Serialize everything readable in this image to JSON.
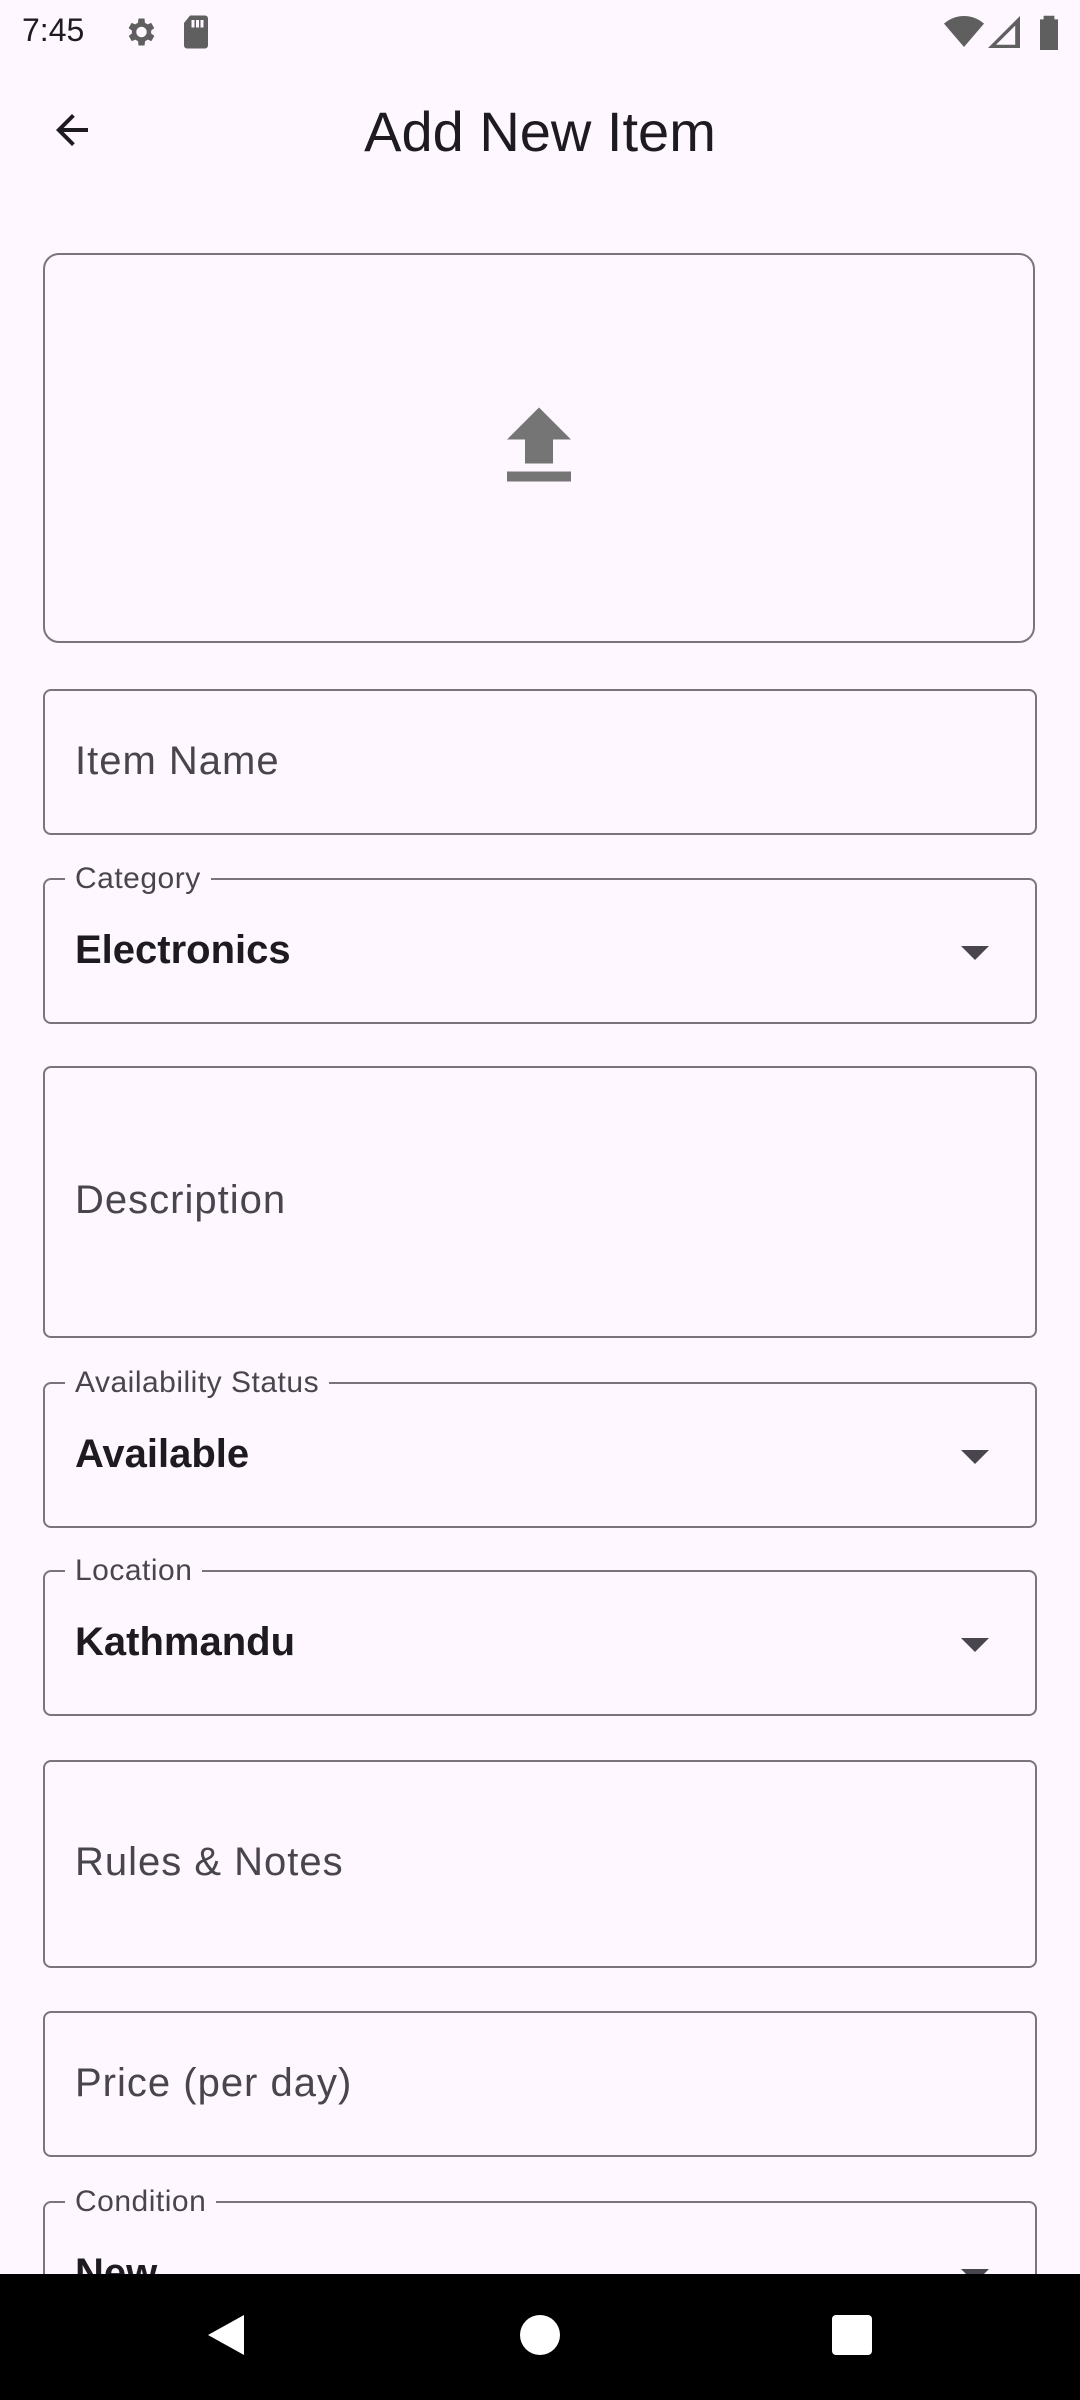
{
  "status_bar": {
    "time": "7:45",
    "icons_left": [
      "gear-icon",
      "sd-card-icon"
    ],
    "icons_right": [
      "wifi-icon",
      "signal-icon",
      "battery-icon"
    ]
  },
  "header": {
    "title": "Add New Item",
    "back_icon": "arrow-back-icon"
  },
  "upload": {
    "icon": "upload-icon"
  },
  "form": {
    "item_name": {
      "placeholder": "Item Name",
      "value": ""
    },
    "category": {
      "label": "Category",
      "value": "Electronics"
    },
    "description": {
      "placeholder": "Description",
      "value": ""
    },
    "availability": {
      "label": "Availability Status",
      "value": "Available"
    },
    "location": {
      "label": "Location",
      "value": "Kathmandu"
    },
    "rules": {
      "placeholder": "Rules & Notes",
      "value": ""
    },
    "price": {
      "placeholder": "Price (per day)",
      "value": ""
    },
    "condition": {
      "label": "Condition",
      "value": "New"
    }
  },
  "colors": {
    "background": "#FEF7FF",
    "outline": "#79747E",
    "text": "#1D1B20",
    "muted": "#49454F"
  },
  "nav": {
    "back_icon": "nav-back-icon",
    "home_icon": "nav-home-icon",
    "recents_icon": "nav-recents-icon"
  }
}
